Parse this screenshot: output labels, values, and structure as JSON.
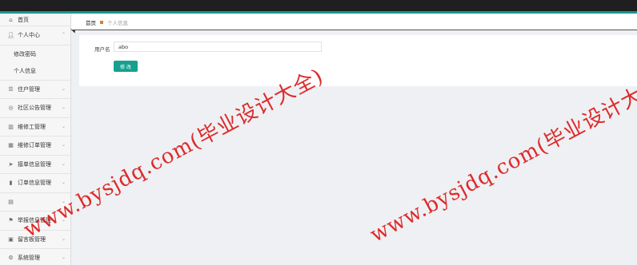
{
  "app": {
    "title": ""
  },
  "sidebar": {
    "items": [
      {
        "label": "首页",
        "icon": "home-icon"
      },
      {
        "label": "个人中心",
        "icon": "user-icon",
        "expanded": true,
        "children": [
          "修改密码",
          "个人信息"
        ]
      },
      {
        "label": "住户管理",
        "icon": "list-icon"
      },
      {
        "label": "社区公告管理",
        "icon": "bell-icon"
      },
      {
        "label": "维修工管理",
        "icon": "chart-icon"
      },
      {
        "label": "维修订单管理",
        "icon": "calendar-icon"
      },
      {
        "label": "接单信息管理",
        "icon": "send-icon"
      },
      {
        "label": "订单信息管理",
        "icon": "bar-chart-icon"
      },
      {
        "label": "",
        "icon": "grid-icon"
      },
      {
        "label": "举报信息管理",
        "icon": "flag-icon"
      },
      {
        "label": "留言板管理",
        "icon": "message-icon"
      },
      {
        "label": "系统管理",
        "icon": "settings-icon"
      }
    ]
  },
  "breadcrumb": {
    "home": "首页",
    "current": "个人信息"
  },
  "form": {
    "username_label": "用户名",
    "username_value": "abo",
    "submit_label": "修 改"
  },
  "watermarks": [
    "www.bysjdq.com(毕业设计大全)",
    "www.bysjdq.com(毕业设计大"
  ],
  "colors": {
    "accent": "#16a08f",
    "topbar": "#1f1f1f",
    "watermark": "#dc1414"
  }
}
